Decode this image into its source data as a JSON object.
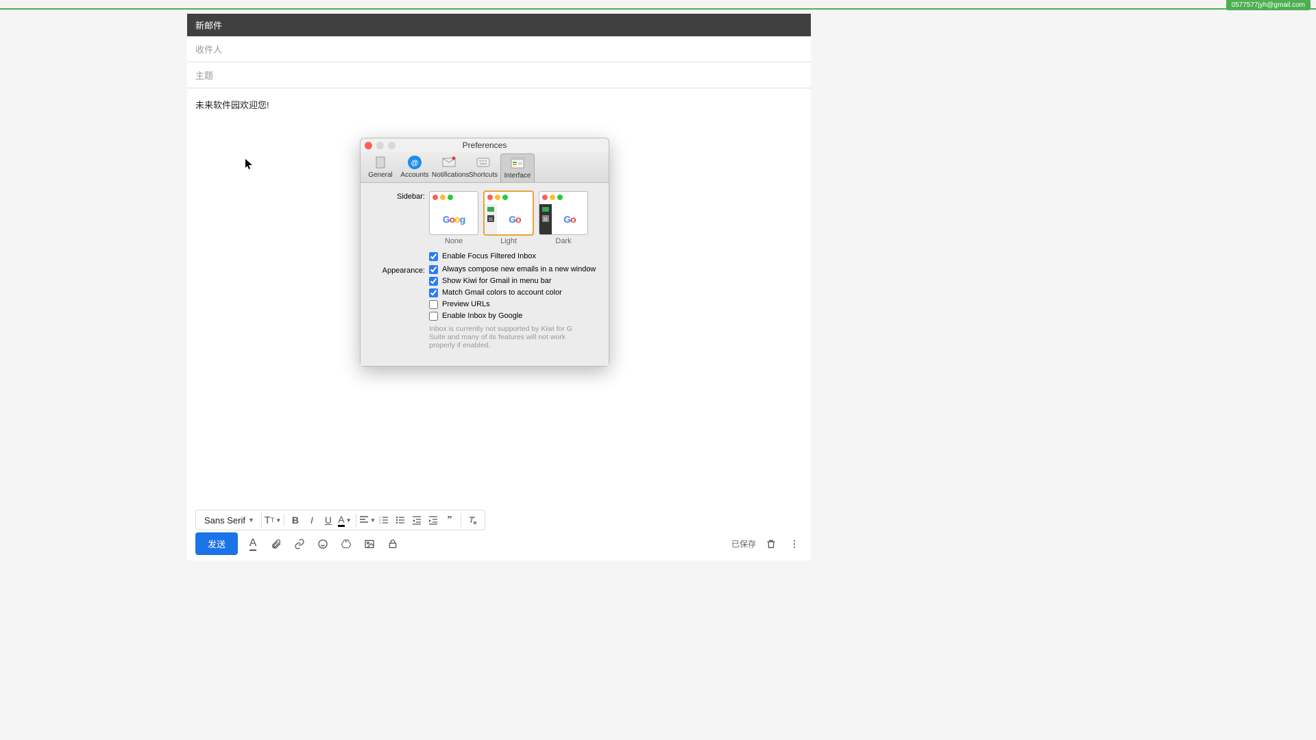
{
  "top": {
    "account_email": "0577577jyh@gmail.com"
  },
  "compose": {
    "title": "新邮件",
    "to_placeholder": "收件人",
    "subject_placeholder": "主题",
    "body_text": "未来软件园欢迎您!",
    "font_name": "Sans Serif",
    "send_label": "发送",
    "saved_label": "已保存"
  },
  "prefs": {
    "title": "Preferences",
    "tabs": {
      "general": "General",
      "accounts": "Accounts",
      "notifications": "Notifications",
      "shortcuts": "Shortcuts",
      "interface": "Interface"
    },
    "labels": {
      "sidebar": "Sidebar:",
      "appearance": "Appearance:"
    },
    "sidebar_options": {
      "none": "None",
      "light": "Light",
      "dark": "Dark"
    },
    "checks": {
      "focus_inbox": "Enable Focus Filtered Inbox",
      "compose_new_window": "Always compose new emails in a new window",
      "show_menu_bar": "Show Kiwi for Gmail in menu bar",
      "match_colors": "Match Gmail colors to account color",
      "preview_urls": "Preview URLs",
      "enable_inbox": "Enable Inbox by Google"
    },
    "help_text": "Inbox is currently not supported by Kiwi for G Suite and many of its features will not work properly if enabled."
  }
}
